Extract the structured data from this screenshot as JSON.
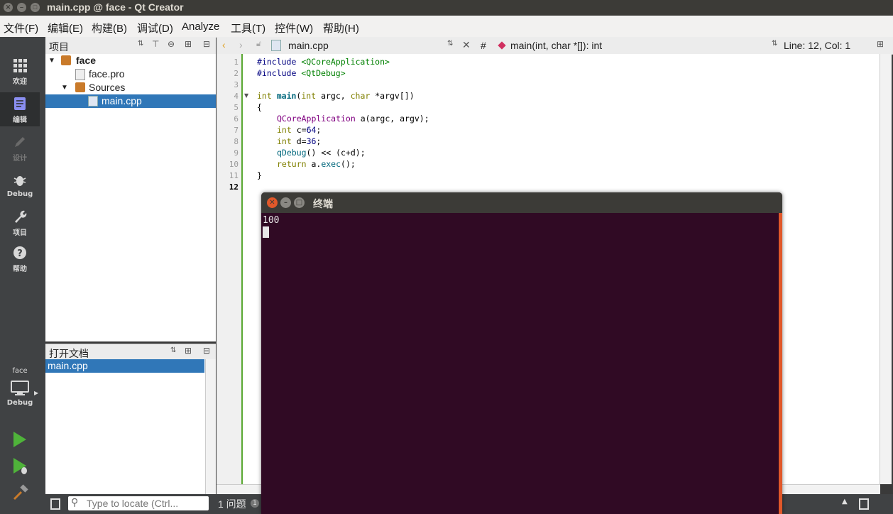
{
  "window": {
    "title": "main.cpp @ face - Qt Creator"
  },
  "menu": [
    "文件(F)",
    "编辑(E)",
    "构建(B)",
    "调试(D)",
    "Analyze",
    "工具(T)",
    "控件(W)",
    "帮助(H)"
  ],
  "modes": {
    "welcome": "欢迎",
    "edit": "编辑",
    "design": "设计",
    "debug": "Debug",
    "projects": "项目",
    "help": "帮助"
  },
  "kit": {
    "project": "face",
    "config": "Debug"
  },
  "projects_panel": {
    "title": "项目",
    "tree": [
      "face",
      "face.pro",
      "Sources",
      "main.cpp"
    ]
  },
  "open_docs": {
    "title": "打开文档",
    "items": [
      "main.cpp"
    ]
  },
  "editor": {
    "file": "main.cpp",
    "hash": "#",
    "symbol": "main(int, char *[]): int",
    "position": "Line: 12, Col: 1",
    "line_numbers": [
      "1",
      "2",
      "3",
      "4",
      "5",
      "6",
      "7",
      "8",
      "9",
      "10",
      "11",
      "12"
    ],
    "code": {
      "l1": "#include",
      "l1b": "<QCoreApplication>",
      "l2": "#include",
      "l2b": "<QtDebug>",
      "l4a": "int",
      "l4b": "main",
      "l4c": "(",
      "l4d": "int",
      "l4e": " argc, ",
      "l4f": "char",
      "l4g": " *argv[])",
      "l5": "{",
      "l6a": "QCoreApplication",
      "l6b": " a(argc, argv);",
      "l7a": "int",
      "l7b": " c=",
      "l7c": "64",
      "l7d": ";",
      "l8a": "int",
      "l8b": " d=",
      "l8c": "36",
      "l8d": ";",
      "l9a": "qDebug",
      "l9b": "() << (c+d);",
      "l10a": "return",
      "l10b": " a.",
      "l10c": "exec",
      "l10d": "();",
      "l11": "}"
    }
  },
  "bottom": {
    "locator_placeholder": "Type to locate (Ctrl...",
    "issues": "1  问题",
    "issues_count": "1"
  },
  "terminal": {
    "title": "终端",
    "output": "100"
  }
}
